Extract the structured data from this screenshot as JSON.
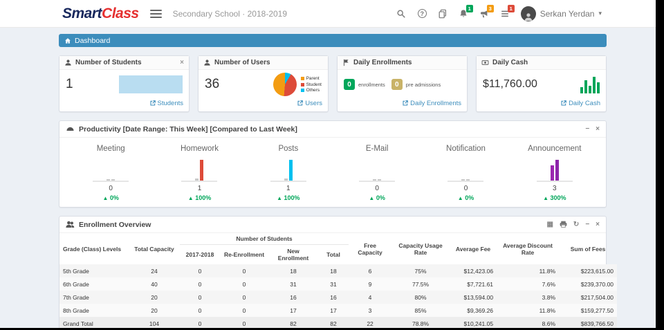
{
  "header": {
    "logo_part1": "Smart",
    "logo_part2": "Class",
    "school_year": "Secondary School · 2018-2019",
    "user_name": "Serkan Yerdan",
    "notif_badge": "1",
    "announce_badge": "3",
    "task_badge": "1",
    "help_glyph": "?"
  },
  "breadcrumb": {
    "label": "Dashboard"
  },
  "icons": {
    "close": "×",
    "collapse": "−",
    "refresh": "↻",
    "export": "▦",
    "caret": "▾",
    "up_arrow": "▲"
  },
  "cards": {
    "students": {
      "title": "Number of Students",
      "value": "1",
      "link": "Students"
    },
    "users": {
      "title": "Number of Users",
      "value": "36",
      "link": "Users",
      "legend": [
        {
          "label": "Parent",
          "color": "#f39c12"
        },
        {
          "label": "Student",
          "color": "#dd4b39"
        },
        {
          "label": "Others",
          "color": "#00c0ef"
        }
      ]
    },
    "enrollments": {
      "title": "Daily Enrollments",
      "badge1_value": "0",
      "badge1_label": "enrollments",
      "badge2_value": "0",
      "badge2_label": "pre admissions",
      "link": "Daily Enrollments"
    },
    "cash": {
      "title": "Daily Cash",
      "value": "$11,760.00",
      "link": "Daily Cash"
    }
  },
  "productivity": {
    "title": "Productivity [Date Range: This Week] [Compared to Last Week]",
    "items": [
      {
        "label": "Meeting",
        "value": "0",
        "change": "0%"
      },
      {
        "label": "Homework",
        "value": "1",
        "change": "100%"
      },
      {
        "label": "Posts",
        "value": "1",
        "change": "100%"
      },
      {
        "label": "E-Mail",
        "value": "0",
        "change": "0%"
      },
      {
        "label": "Notification",
        "value": "0",
        "change": "0%"
      },
      {
        "label": "Announcement",
        "value": "3",
        "change": "300%"
      }
    ],
    "colors": {
      "homework": "#dd4b39",
      "posts": "#00c0ef",
      "announcement": "#9c27b0",
      "neutral": "#c9c9c9"
    }
  },
  "enrollment": {
    "title": "Enrollment Overview",
    "group_label": "Number of Students",
    "columns": [
      "Grade (Class) Levels",
      "Total Capacity",
      "2017-2018",
      "Re-Enrollment",
      "New Enrollment",
      "Total",
      "Free Capacity",
      "Capacity Usage Rate",
      "Average Fee",
      "Average Discount Rate",
      "Sum of Fees"
    ],
    "rows": [
      [
        "5th Grade",
        "24",
        "0",
        "0",
        "18",
        "18",
        "6",
        "75%",
        "$12,423.06",
        "11.8%",
        "$223,615.00"
      ],
      [
        "6th Grade",
        "40",
        "0",
        "0",
        "31",
        "31",
        "9",
        "77.5%",
        "$7,721.61",
        "7.6%",
        "$239,370.00"
      ],
      [
        "7th Grade",
        "20",
        "0",
        "0",
        "16",
        "16",
        "4",
        "80%",
        "$13,594.00",
        "3.8%",
        "$217,504.00"
      ],
      [
        "8th Grade",
        "20",
        "0",
        "0",
        "17",
        "17",
        "3",
        "85%",
        "$9,369.26",
        "11.8%",
        "$159,277.50"
      ],
      [
        "Grand Total",
        "104",
        "0",
        "0",
        "82",
        "82",
        "22",
        "78.8%",
        "$10,241.05",
        "8.6%",
        "$839,766.50"
      ]
    ]
  }
}
